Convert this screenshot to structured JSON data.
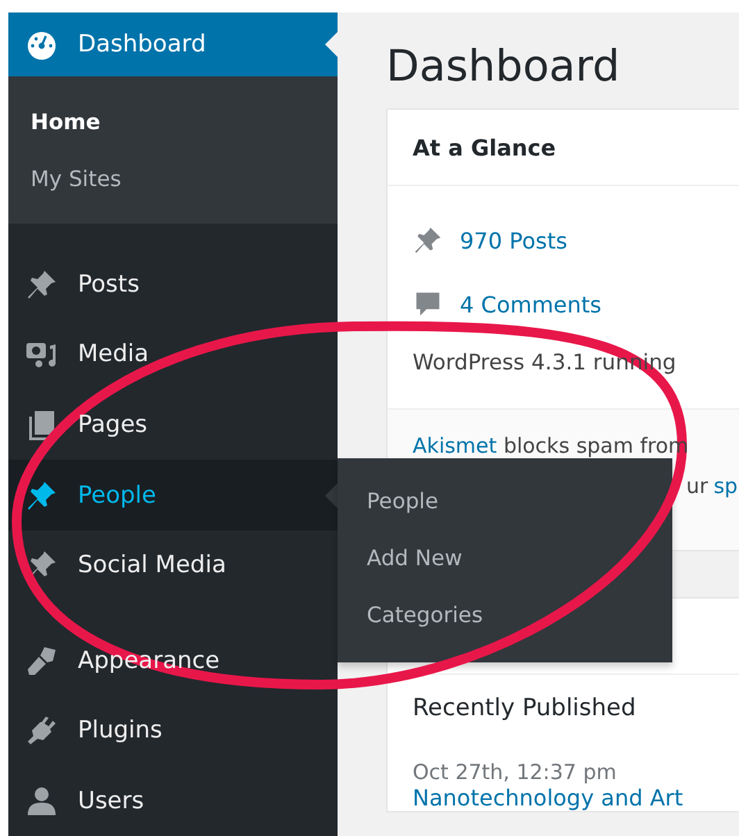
{
  "sidebar": {
    "items": [
      {
        "label": "Dashboard",
        "selected": true,
        "hovered": false,
        "gap_before": false,
        "children": [
          {
            "label": "Home",
            "selected": true
          },
          {
            "label": "My Sites",
            "selected": false
          }
        ]
      },
      {
        "label": "Posts",
        "selected": false,
        "hovered": false,
        "gap_before": false
      },
      {
        "label": "Media",
        "selected": false,
        "hovered": false,
        "gap_before": false
      },
      {
        "label": "Pages",
        "selected": false,
        "hovered": false,
        "gap_before": false
      },
      {
        "label": "People",
        "selected": false,
        "hovered": true,
        "gap_before": false,
        "flyout": [
          "People",
          "Add New",
          "Categories"
        ]
      },
      {
        "label": "Social Media",
        "selected": false,
        "hovered": false,
        "gap_before": false
      },
      {
        "label": "Appearance",
        "selected": false,
        "hovered": false,
        "gap_before": true
      },
      {
        "label": "Plugins",
        "selected": false,
        "hovered": false,
        "gap_before": false
      },
      {
        "label": "Users",
        "selected": false,
        "hovered": false,
        "gap_before": false
      }
    ]
  },
  "page_title": "Dashboard",
  "glance": {
    "title": "At a Glance",
    "stats": [
      "970 Posts",
      "4 Comments"
    ],
    "version_line": "WordPress 4.3.1 running",
    "akismet_link": "Akismet",
    "akismet_text": "blocks spam from",
    "akismet_line2": "ur",
    "akismet_line2_link": "sp"
  },
  "activity": {
    "title": "Recently Published",
    "date": "Oct 27th, 12:37 pm",
    "post_link": "Nanotechnology and Art"
  },
  "annotation": {
    "kind": "ellipse"
  }
}
